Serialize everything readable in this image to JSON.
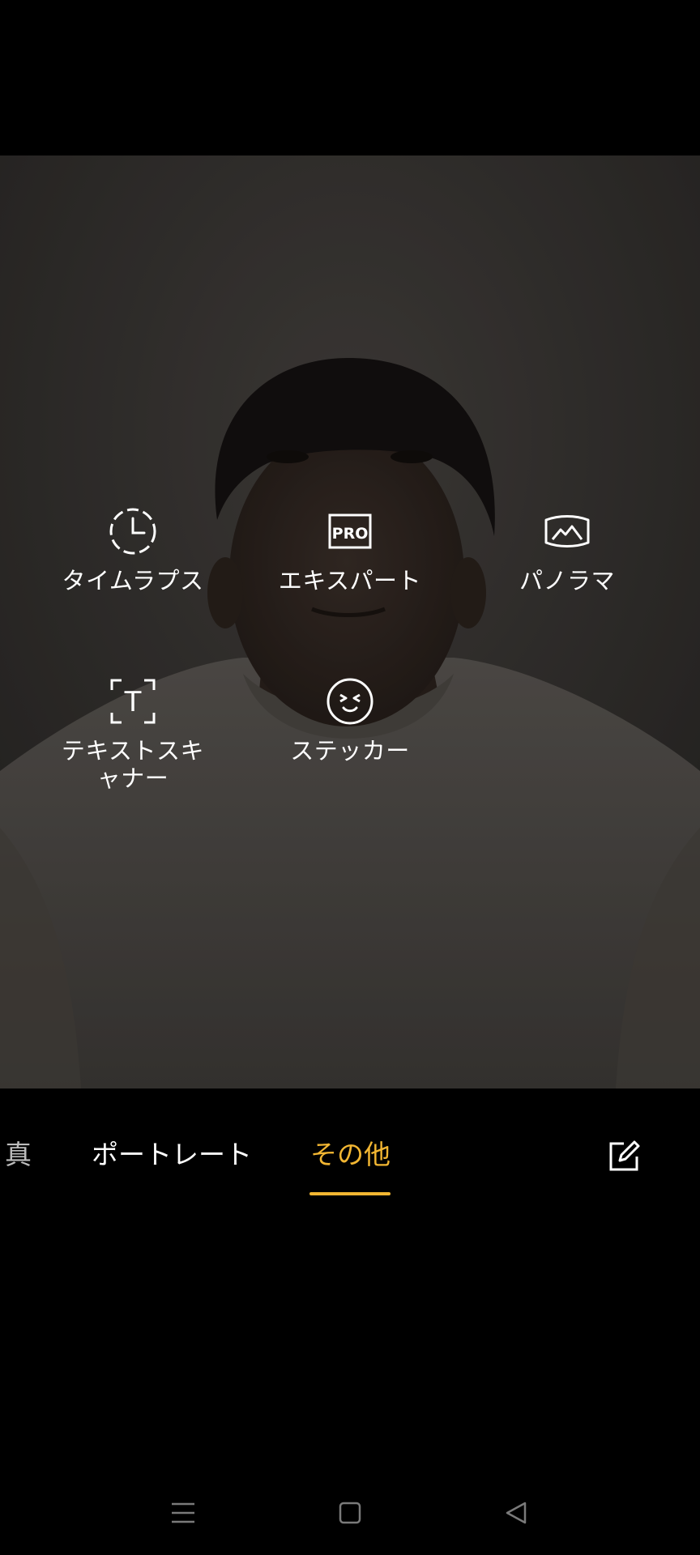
{
  "camera": {
    "modes_grid": [
      {
        "id": "timelapse",
        "label": "タイムラプス",
        "icon": "timelapse-clock-icon"
      },
      {
        "id": "expert",
        "label": "エキスパート",
        "icon": "pro-icon",
        "icon_text": "PRO"
      },
      {
        "id": "panorama",
        "label": "パノラマ",
        "icon": "panorama-mountain-icon"
      },
      {
        "id": "text_scanner",
        "label": "テキストスキャナー",
        "label_line1": "テキストスキ",
        "label_line2": "ャナー",
        "icon": "text-scanner-icon",
        "icon_text": "T"
      },
      {
        "id": "sticker",
        "label": "ステッカー",
        "icon": "sticker-face-icon"
      }
    ],
    "mode_bar": {
      "items": [
        {
          "label": "写真",
          "visible_text": "真",
          "state": "partial"
        },
        {
          "label": "ポートレート",
          "state": "normal"
        },
        {
          "label": "その他",
          "state": "active"
        }
      ],
      "edit_icon": "edit-icon",
      "active_color": "#f2b632"
    }
  },
  "navbar": {
    "buttons": [
      "menu-icon",
      "home-icon",
      "back-icon"
    ]
  }
}
